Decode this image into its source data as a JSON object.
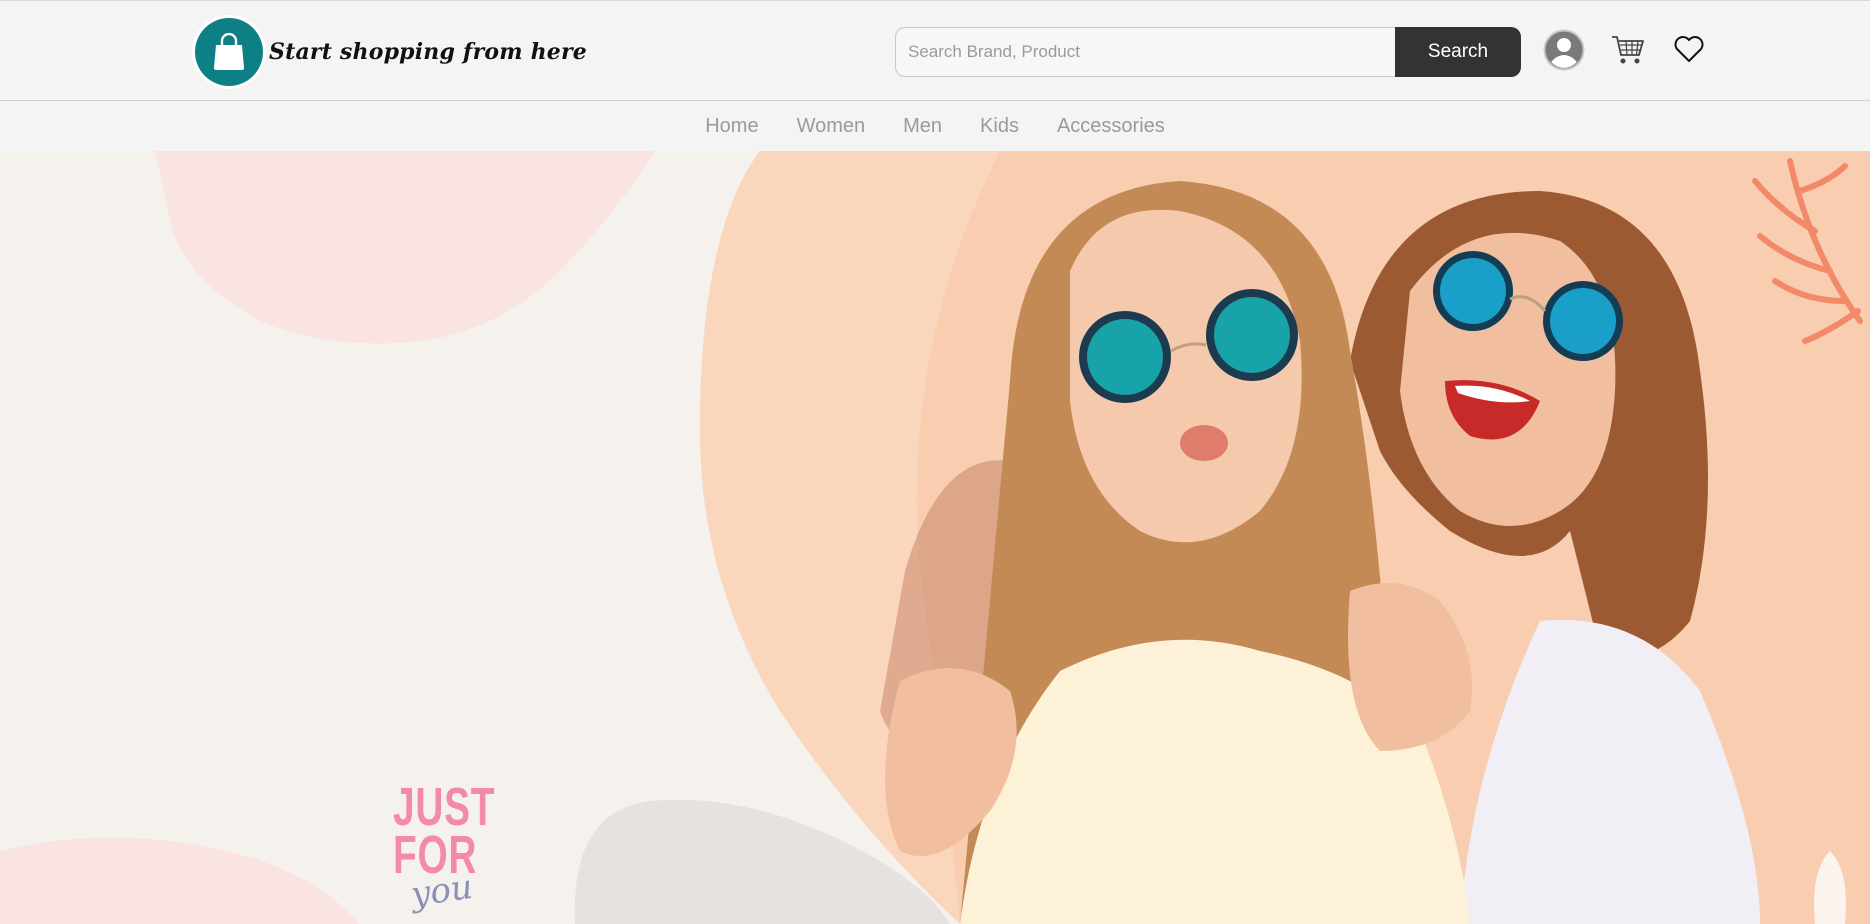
{
  "header": {
    "logo_text": "Start shopping from here",
    "search": {
      "placeholder": "Search Brand, Product",
      "value": "",
      "button_label": "Search"
    },
    "icons": [
      "user-icon",
      "cart-icon",
      "heart-icon"
    ]
  },
  "nav": {
    "items": [
      {
        "label": "Home"
      },
      {
        "label": "Women"
      },
      {
        "label": "Men"
      },
      {
        "label": "Kids"
      },
      {
        "label": "Accessories"
      }
    ]
  },
  "hero": {
    "tagline_line1": "JUST",
    "tagline_line2": "FOR",
    "tagline_line3": "you"
  },
  "colors": {
    "brand": "#0f7f86",
    "search_button": "#333333",
    "nav_text": "#9a9a9a",
    "hero_background": "#f5f2ee",
    "hero_peach": "#f8cdb0",
    "accent_coral": "#f28a6a",
    "accent_pink": "#f28aa8"
  }
}
